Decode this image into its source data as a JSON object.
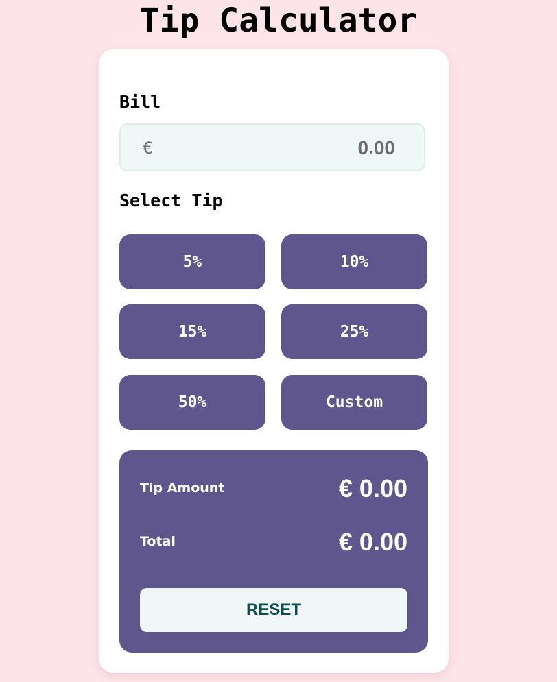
{
  "app": {
    "title": "Tip Calculator"
  },
  "bill": {
    "label": "Bill",
    "currency_symbol": "€",
    "placeholder": "0.00",
    "value": ""
  },
  "tip": {
    "label": "Select Tip",
    "options": [
      "5%",
      "10%",
      "15%",
      "25%",
      "50%",
      "Custom"
    ]
  },
  "results": {
    "tip_amount_label": "Tip Amount",
    "tip_amount_value": "€ 0.00",
    "total_label": "Total",
    "total_value": "€ 0.00",
    "reset_label": "RESET"
  },
  "colors": {
    "page_background": "#fde4e8",
    "card_background": "#ffffff",
    "accent_purple": "#5f568d",
    "input_background": "#eff7f7",
    "reset_text": "#0e4f4c"
  }
}
